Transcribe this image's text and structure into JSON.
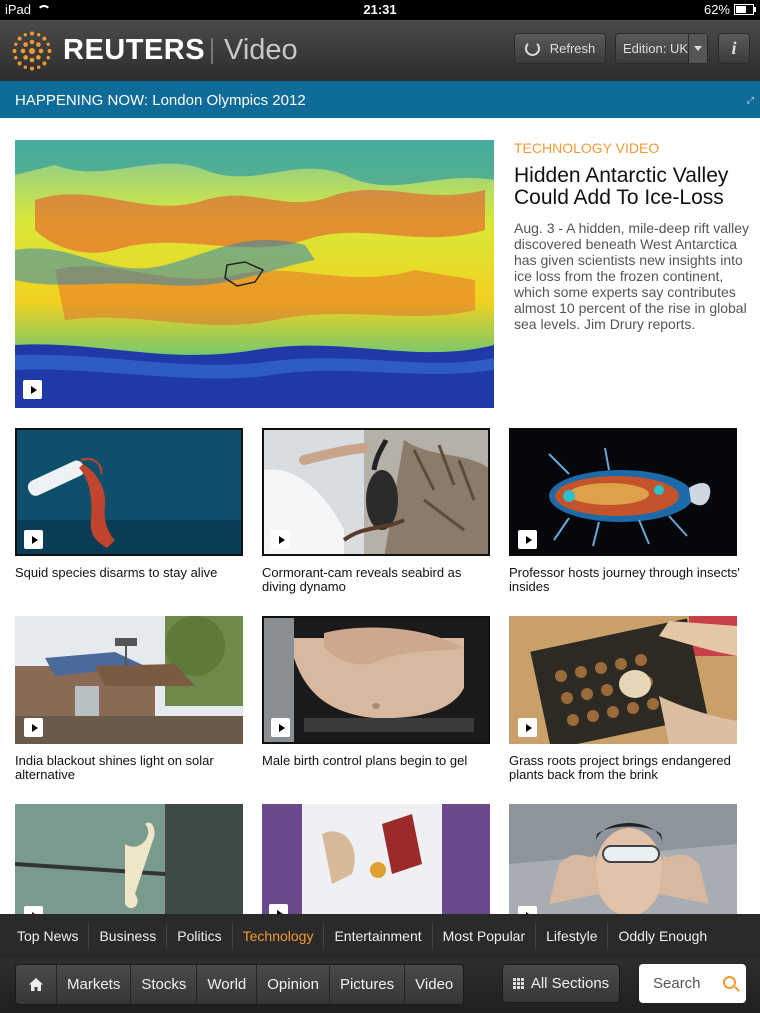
{
  "status": {
    "device": "iPad",
    "time": "21:31",
    "battery": "62%",
    "battery_level": 0.62
  },
  "header": {
    "brand": "REUTERS",
    "section": "Video",
    "refresh_label": "Refresh",
    "edition_label": "Edition: UK",
    "info_label": "i"
  },
  "banner": {
    "text": "HAPPENING NOW: London Olympics 2012"
  },
  "featured": {
    "category": "TECHNOLOGY VIDEO",
    "title": "Hidden Antarctic Valley Could Add To Ice-Loss",
    "description": "Aug. 3 - A hidden, mile-deep rift valley discovered beneath West Antarctica has given scientists new insights into ice loss from the frozen continent, which some experts say contributes almost 10 percent of the rise in global sea levels. Jim Drury reports."
  },
  "videos": [
    {
      "caption": "Squid species disarms to stay alive"
    },
    {
      "caption": "Cormorant-cam reveals seabird as diving dynamo"
    },
    {
      "caption": "Professor hosts journey through insects' insides"
    },
    {
      "caption": "India blackout shines light on solar alternative"
    },
    {
      "caption": "Male birth control plans begin to gel"
    },
    {
      "caption": "Grass roots project brings endangered plants back from the brink"
    },
    {
      "caption": ""
    },
    {
      "caption": ""
    },
    {
      "caption": ""
    }
  ],
  "section_nav": [
    "Top News",
    "Business",
    "Politics",
    "Technology",
    "Entertainment",
    "Most Popular",
    "Lifestyle",
    "Oddly Enough"
  ],
  "active_section": "Technology",
  "toolbar": {
    "items": [
      "Markets",
      "Stocks",
      "World",
      "Opinion",
      "Pictures",
      "Video"
    ],
    "all_sections_label": "All Sections",
    "search_placeholder": "Search"
  },
  "colors": {
    "accent": "#f29a34",
    "banner": "#0f6b98",
    "header": "#2c2c2c"
  }
}
